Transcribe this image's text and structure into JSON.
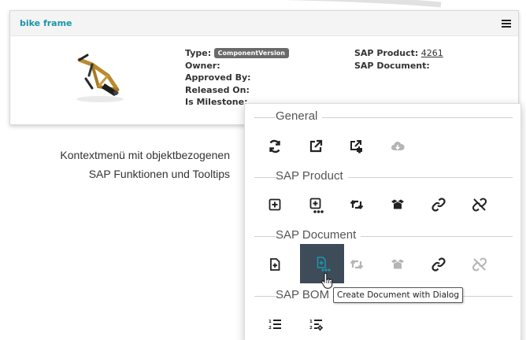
{
  "card": {
    "title": "bike frame",
    "image_alt": "bike frame thumbnail",
    "fields_left": [
      {
        "label": "Type:",
        "badge": "ComponentVersion"
      },
      {
        "label": "Owner:",
        "value": ""
      },
      {
        "label": "Approved By:",
        "value": ""
      },
      {
        "label": "Released On:",
        "value": ""
      },
      {
        "label": "Is Milestone:",
        "value": ""
      }
    ],
    "fields_right": [
      {
        "label": "SAP Product:",
        "value": "4261"
      },
      {
        "label": "SAP Document:",
        "value": ""
      }
    ]
  },
  "caption": {
    "line1": "Kontextmenü mit objektbezogenen",
    "line2": "SAP Funktionen und Tooltips"
  },
  "menu": {
    "groups": [
      {
        "title": "General",
        "items": [
          {
            "icon": "refresh-icon",
            "enabled": true
          },
          {
            "icon": "external-link-icon",
            "enabled": true
          },
          {
            "icon": "open-in-window-icon",
            "enabled": true
          },
          {
            "icon": "cloud-download-icon",
            "enabled": false
          }
        ]
      },
      {
        "title": "SAP Product",
        "items": [
          {
            "icon": "plus-square-icon",
            "enabled": true
          },
          {
            "icon": "plus-square-dialog-icon",
            "enabled": true
          },
          {
            "icon": "retweet-icon",
            "enabled": true
          },
          {
            "icon": "box-open-icon",
            "enabled": true
          },
          {
            "icon": "link-icon",
            "enabled": true
          },
          {
            "icon": "unlink-icon",
            "enabled": true
          }
        ]
      },
      {
        "title": "SAP Document",
        "items": [
          {
            "icon": "file-plus-icon",
            "enabled": true
          },
          {
            "icon": "file-plus-dialog-icon",
            "enabled": true,
            "active": true
          },
          {
            "icon": "retweet-icon",
            "enabled": false
          },
          {
            "icon": "box-open-icon",
            "enabled": false
          },
          {
            "icon": "link-icon",
            "enabled": true
          },
          {
            "icon": "unlink-icon",
            "enabled": false
          }
        ]
      },
      {
        "title": "SAP BOM",
        "items": [
          {
            "icon": "list-ol-icon",
            "enabled": true
          },
          {
            "icon": "list-ol-settings-icon",
            "enabled": true
          }
        ]
      }
    ],
    "tooltip": "Create Document with Dialog"
  },
  "colors": {
    "accent": "#1a95a8",
    "icon": "#222222",
    "disabled": "#b5b5b5",
    "active_bg": "#3e4b58"
  }
}
